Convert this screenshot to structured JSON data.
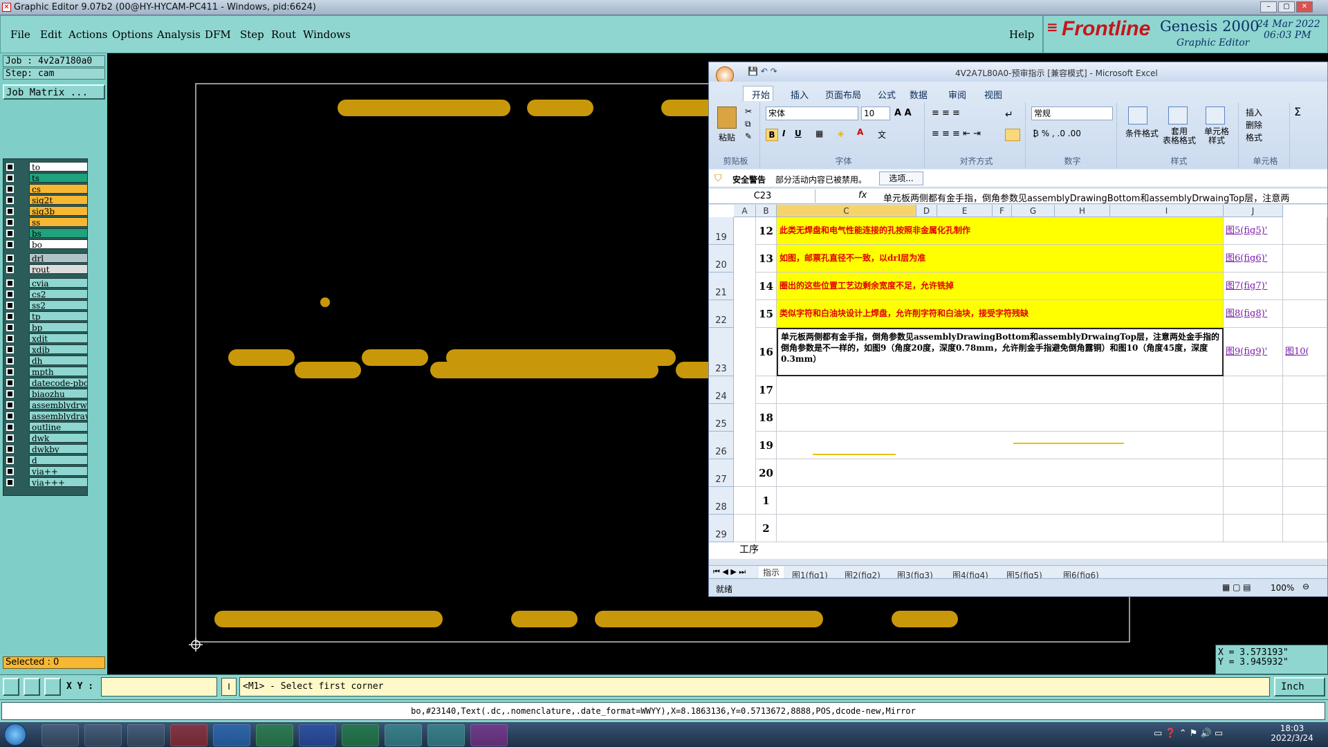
{
  "window": {
    "title": "Graphic Editor 9.07b2 (00@HY-HYCAM-PC411 - Windows, pid:6624)"
  },
  "menu": {
    "items": [
      "File",
      "Edit",
      "Actions",
      "Options",
      "Analysis",
      "DFM",
      "Step",
      "Rout",
      "Windows"
    ],
    "help": "Help"
  },
  "brand": {
    "logo": "Frontline",
    "product": "Genesis 2000",
    "subtitle": "Graphic Editor",
    "date": "24 Mar 2022",
    "time": "06:03 PM"
  },
  "job": {
    "job_label": "Job : 4v2a7180a0",
    "step_label": "Step: cam",
    "matrix_button": "Job Matrix ..."
  },
  "layers": [
    {
      "name": "to",
      "color": "#ffffff"
    },
    {
      "name": "ts",
      "color": "#1fa37d"
    },
    {
      "name": "cs",
      "color": "#f7b733"
    },
    {
      "name": "sig2t",
      "color": "#f7b733"
    },
    {
      "name": "sig3b",
      "color": "#f7b733"
    },
    {
      "name": "ss",
      "color": "#f7b733"
    },
    {
      "name": "bs",
      "color": "#1fa37d"
    },
    {
      "name": "bo",
      "color": "#ffffff"
    },
    {
      "name": "drl",
      "color": "#b0c4c8"
    },
    {
      "name": "rout",
      "color": "#dddddd"
    },
    {
      "name": "cvia",
      "color": "#8fd6d0"
    },
    {
      "name": "cs2",
      "color": "#8fd6d0"
    },
    {
      "name": "ss2",
      "color": "#8fd6d0"
    },
    {
      "name": "tp",
      "color": "#8fd6d0"
    },
    {
      "name": "bp",
      "color": "#8fd6d0"
    },
    {
      "name": "xdjt",
      "color": "#8fd6d0"
    },
    {
      "name": "xdjb",
      "color": "#8fd6d0"
    },
    {
      "name": "dh",
      "color": "#8fd6d0"
    },
    {
      "name": "mpth",
      "color": "#8fd6d0"
    },
    {
      "name": "datecode-pbo",
      "color": "#8fd6d0"
    },
    {
      "name": "biaozhu",
      "color": "#8fd6d0"
    },
    {
      "name": "assemblydrwa",
      "color": "#8fd6d0"
    },
    {
      "name": "assemblydraw",
      "color": "#8fd6d0"
    },
    {
      "name": "outline",
      "color": "#8fd6d0"
    },
    {
      "name": "dwk",
      "color": "#8fd6d0"
    },
    {
      "name": "dwkby",
      "color": "#8fd6d0"
    },
    {
      "name": "d",
      "color": "#8fd6d0"
    },
    {
      "name": "via++",
      "color": "#8fd6d0"
    },
    {
      "name": "via+++",
      "color": "#8fd6d0"
    }
  ],
  "selected": "Selected : 0",
  "excel": {
    "title": "4V2A7L80A0-预审指示  [兼容模式] - Microsoft Excel",
    "tabs": [
      "开始",
      "插入",
      "页面布局",
      "公式",
      "数据",
      "审阅",
      "视图"
    ],
    "groups": [
      "剪贴板",
      "字体",
      "对齐方式",
      "数字",
      "样式",
      "单元格"
    ],
    "paste": "粘贴",
    "font": "宋体",
    "font_size": "10",
    "number_format": "常规",
    "style_buttons": [
      "条件格式",
      "套用\n表格格式",
      "单元格\n样式"
    ],
    "cell_buttons": [
      "插入",
      "删除",
      "格式"
    ],
    "security": {
      "title": "安全警告",
      "message": "部分活动内容已被禁用。",
      "button": "选项..."
    },
    "name_box": "C23",
    "formula": "单元板两侧都有金手指，倒角参数见assemblyDrawingBottom和assemblyDrwaingTop层，注意两",
    "columns": [
      "A",
      "B",
      "C",
      "D",
      "E",
      "F",
      "G",
      "H",
      "I",
      "J"
    ],
    "rows": [
      {
        "num": "19",
        "b": "12",
        "text": "此类无焊盘和电气性能连接的孔按照非金属化孔制作",
        "link": "图5(fig5)'"
      },
      {
        "num": "20",
        "b": "13",
        "text": "如图，邮票孔直径不一致，以drl层为准",
        "link": "图6(fig6)'"
      },
      {
        "num": "21",
        "b": "14",
        "text": "圈出的这些位置工艺边剩余宽度不足，允许铣掉",
        "link": "图7(fig7)'"
      },
      {
        "num": "22",
        "b": "15",
        "text": "类似字符和白油块设计上焊盘，允许削字符和白油块，接受字符残缺",
        "link": "图8(fig8)'"
      },
      {
        "num": "23",
        "b": "16",
        "text": "单元板两侧都有金手指，倒角参数见assemblyDrawingBottom和assemblyDrwaingTop层，注意两处金手指的倒角参数是不一样的，如图9（角度20度，深度0.78mm，允许削金手指避免倒角露铜）和图10（角度45度，深度0.3mm）",
        "link": "图9(fig9)'",
        "link2": "图10("
      },
      {
        "num": "24",
        "b": "17",
        "text": "",
        "link": ""
      },
      {
        "num": "25",
        "b": "18",
        "text": "",
        "link": ""
      },
      {
        "num": "26",
        "b": "19",
        "text": "",
        "link": ""
      },
      {
        "num": "27",
        "b": "20",
        "text": "",
        "link": ""
      },
      {
        "num": "28",
        "b": "1",
        "text": "",
        "link": ""
      },
      {
        "num": "29",
        "b": "2",
        "text": "",
        "link": ""
      }
    ],
    "a_label": "工序",
    "sheets": [
      "指示",
      "图1(fig1)",
      "图2(fig2)",
      "图3(fig3)",
      "图4(fig4)",
      "图5(fig5)",
      "图6(fig6)"
    ],
    "status": "就绪",
    "zoom": "100%"
  },
  "coords": {
    "x": "X = 3.573193\"",
    "y": "Y = 3.945932\""
  },
  "cmd": {
    "xy_label": "X Y :",
    "prompt": "<M1> - Select first corner",
    "unit": "Inch"
  },
  "status_line": "bo,#23140,Text(.dc,.nomenclature,.date_format=WWYY),X=8.1863136,Y=0.5713672,8888,POS,dcode-new,Mirror",
  "clock": {
    "time": "18:03",
    "date": "2022/3/24"
  },
  "colors": {
    "accent": "#8fd6d0",
    "pad": "#c9980a",
    "row_highlight": "#ffff00",
    "row_text": "#e00000"
  }
}
